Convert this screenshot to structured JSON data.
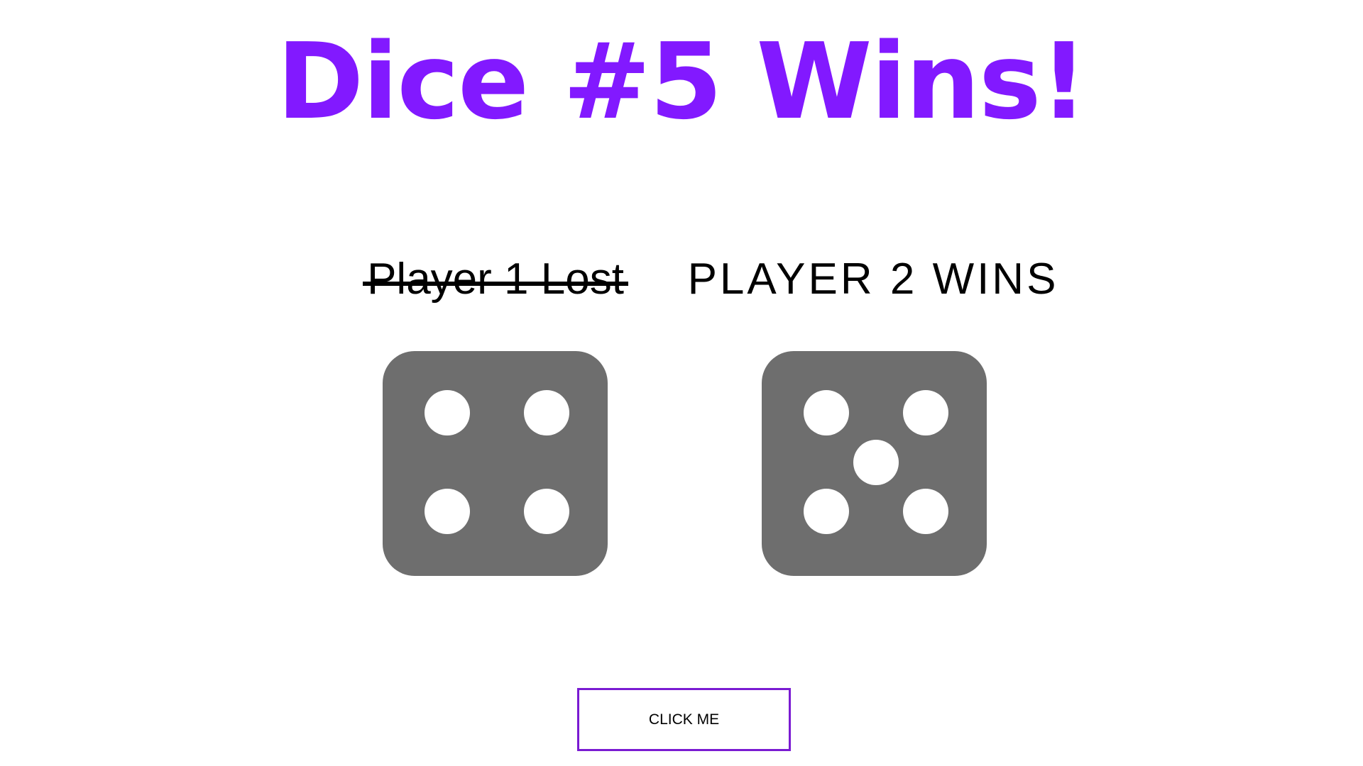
{
  "title": "Dice #5 Wins!",
  "accent_color": "#8219ff",
  "die_color": "#6e6e6e",
  "pip_color": "#ffffff",
  "players": [
    {
      "label": "Player 1 Lost",
      "status": "lost",
      "die_value": 4,
      "die_icon": "dice-four-icon"
    },
    {
      "label": "PLAYER 2 WINS",
      "status": "won",
      "die_value": 5,
      "die_icon": "dice-five-icon"
    }
  ],
  "button": {
    "label": "CLICK ME",
    "border_color": "#7a1bd2"
  }
}
